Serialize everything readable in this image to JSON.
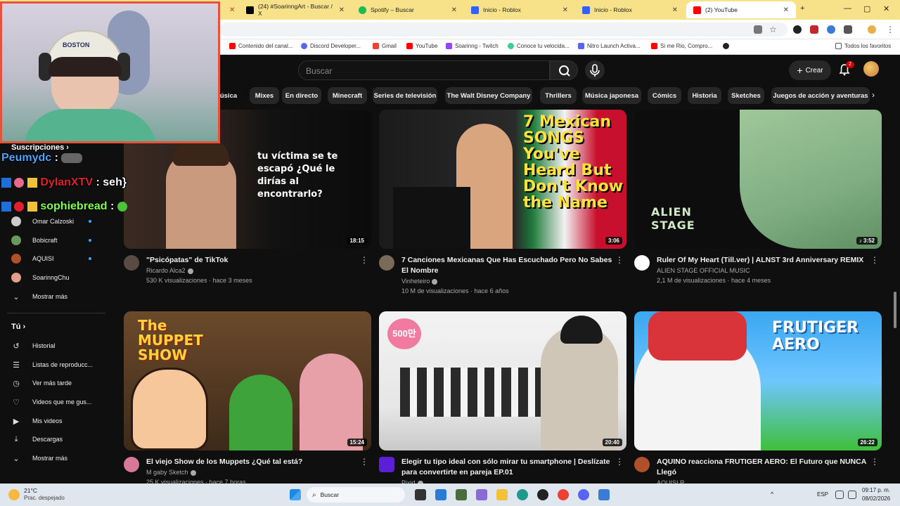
{
  "browser": {
    "tabs": [
      {
        "label": "(24) #SoarinngArt - Buscar / X",
        "icon": "x-logo-icon"
      },
      {
        "label": "Spotify – Buscar",
        "icon": "spotify-icon"
      },
      {
        "label": "Inicio - Roblox",
        "icon": "roblox-icon"
      },
      {
        "label": "Inicio - Roblox",
        "icon": "roblox-icon"
      },
      {
        "label": "(2) YouTube",
        "icon": "youtube-icon"
      }
    ],
    "bookmarks": [
      "Contenido del canal...",
      "Discord Developer...",
      "Gmail",
      "YouTube",
      "Soarinng - Twitch",
      "Conoce tu velocida...",
      "Nitro Launch Activa...",
      "Si me Rio, Compro..."
    ],
    "all_bookmarks": "Todos los favoritos"
  },
  "header": {
    "search_placeholder": "Buscar",
    "create_label": "Crear",
    "notifications_count": "2"
  },
  "chips": [
    "úsica",
    "Mixes",
    "En directo",
    "Minecraft",
    "Series de televisión",
    "The Walt Disney Company",
    "Thrillers",
    "Música japonesa",
    "Cómics",
    "Historia",
    "Sketches",
    "Juegos de acción y aventuras"
  ],
  "sidebar": {
    "subscriptions_heading": "Suscripciones",
    "subscriptions": [
      {
        "label": "Omar Calzoski",
        "color": "#cccccc"
      },
      {
        "label": "Bobicraft",
        "color": "#6a9a5a"
      },
      {
        "label": "AQUISI",
        "color": "#b0502a"
      },
      {
        "label": "SoarinngChu",
        "color": "#e2a08a"
      }
    ],
    "show_more": "Mostrar más",
    "you_heading": "Tú",
    "you_items": [
      {
        "label": "Historial",
        "icon": "history-icon"
      },
      {
        "label": "Listas de reproducc...",
        "icon": "playlists-icon"
      },
      {
        "label": "Ver más tarde",
        "icon": "watch-later-icon"
      },
      {
        "label": "Videos que me gus...",
        "icon": "like-icon"
      },
      {
        "label": "Mis videos",
        "icon": "my-videos-icon"
      },
      {
        "label": "Descargas",
        "icon": "download-icon"
      }
    ],
    "show_more_2": "Mostrar más"
  },
  "videos": [
    {
      "title": "\"Psicópatas\" de TikTok",
      "channel": "Ricardo Alca2",
      "stats": "530 K visualizaciones · hace 3 meses",
      "duration": "18:15",
      "thumb_text": "tu víctima se te escapó ¿Qué le dirías al encontrarlo?"
    },
    {
      "title": "7 Canciones Mexicanas Que Has Escuchado Pero No Sabes El Nombre",
      "channel": "Vinheteiro",
      "stats": "10 M de visualizaciones · hace 6 años",
      "duration": "3:06",
      "thumb_text": "7 Mexican SONGS You've Heard But Don't Know the Name"
    },
    {
      "title": "Ruler Of My Heart (Till.ver)   |   ALNST 3rd Anniversary REMIX",
      "channel": "ALIEN STAGE OFFICIAL MUSIC",
      "stats": "2,1 M de visualizaciones · hace 4 meses",
      "duration": "3:52",
      "thumb_text": "ALIEN STAGE"
    },
    {
      "title": "El viejo Show de los Muppets ¿Qué tal está?",
      "channel": "M gaby Sketch",
      "stats": "25 K visualizaciones · hace 7 horas",
      "duration": "15:24",
      "thumb_text": "The MUPPET SHOW"
    },
    {
      "title": "Elegir tu tipo ideal con sólo mirar tu smartphone | Deslízate para convertirte en pareja EP.01",
      "channel": "Pixid",
      "stats": "",
      "duration": "20:40",
      "thumb_text": "500만"
    },
    {
      "title": "AQUINO reacciona FRUTIGER AERO: El Futuro que NUNCA Llegó",
      "channel": "AQUISI R",
      "stats": "",
      "duration": "26:22",
      "thumb_text": "FRUTIGER AERO"
    }
  ],
  "overlay": {
    "cap_text": "BOSTON",
    "chat": [
      {
        "user": "Peumydc",
        "message": ":",
        "color": "#4aa3ff"
      },
      {
        "user": "DylanXTV",
        "message": ": seh}",
        "color": "#e0202a"
      },
      {
        "user": "sophiebread",
        "message": ":",
        "color": "#7cff4a"
      }
    ]
  },
  "taskbar": {
    "weather_temp": "21°C",
    "weather_desc": "Prac. despejado",
    "search": "Buscar",
    "lang": "ESP",
    "time": "09:17 p. m.",
    "date": "08/02/2026"
  }
}
